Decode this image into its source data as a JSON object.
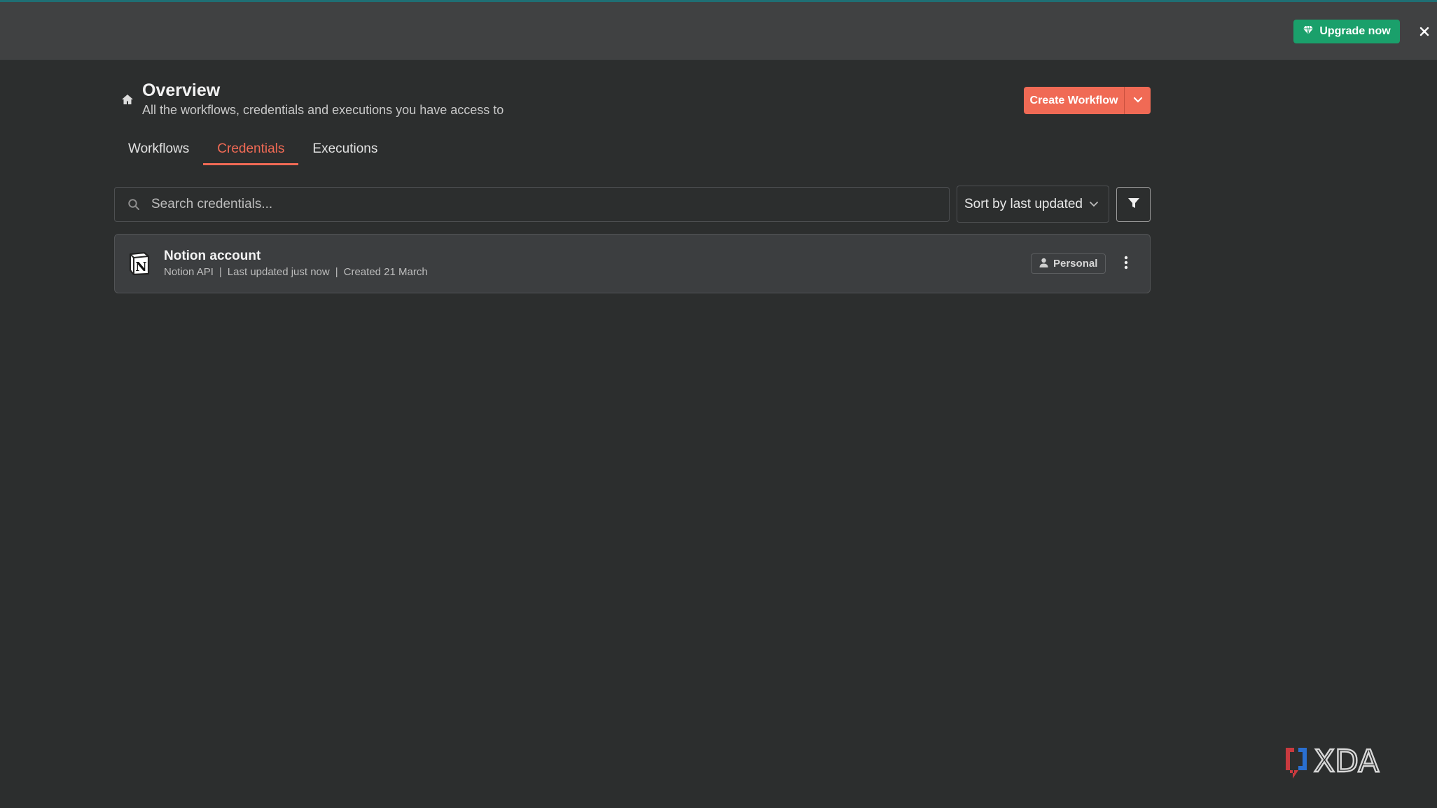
{
  "topbar": {
    "upgrade_label": "Upgrade now",
    "upgrade_icon": "gem-icon",
    "close_icon": "close-icon",
    "accent": "#1aa06b"
  },
  "header": {
    "title": "Overview",
    "subtitle": "All the workflows, credentials and executions you have access to",
    "icon": "home-icon"
  },
  "create": {
    "label": "Create Workflow",
    "dropdown_icon": "chevron-down-icon",
    "color": "#f06a55"
  },
  "tabs": [
    {
      "label": "Workflows",
      "active": false
    },
    {
      "label": "Credentials",
      "active": true
    },
    {
      "label": "Executions",
      "active": false
    }
  ],
  "search": {
    "placeholder": "Search credentials...",
    "value": ""
  },
  "sort": {
    "selected": "Sort by last updated"
  },
  "credentials": [
    {
      "name": "Notion account",
      "type": "Notion API",
      "updated": "Last updated just now",
      "created": "Created 21 March",
      "badge": "Personal",
      "icon": "notion-logo-icon"
    }
  ],
  "watermark": {
    "text": "XDA"
  }
}
